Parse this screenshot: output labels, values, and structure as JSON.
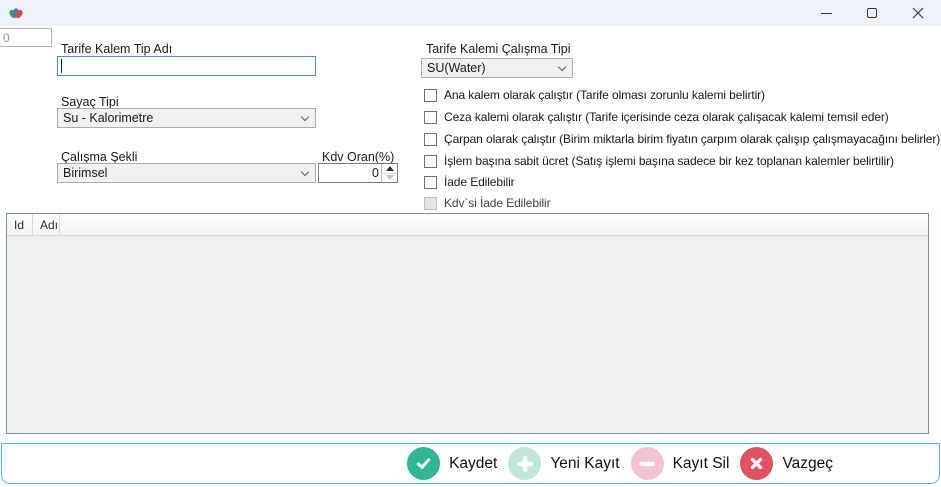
{
  "window": {
    "title": "",
    "icons": {
      "app_logo": "app-logo-icon",
      "minimize": "minimize-icon",
      "maximize": "maximize-icon",
      "close": "close-icon",
      "combo_chevron": "chevron-down-icon",
      "spinner_up": "arrow-up-icon",
      "spinner_down": "arrow-down-icon"
    }
  },
  "header_input": {
    "value": "0"
  },
  "form": {
    "name_field": {
      "label": "Tarife Kalem Tip Adı",
      "value": ""
    },
    "meter_type": {
      "label": "Sayaç Tipi",
      "value": "Su - Kalorimetre"
    },
    "work_mode": {
      "label": "Çalışma Şekli",
      "value": "Birimsel"
    },
    "vat_rate": {
      "label": "Kdv Oran(%)",
      "value": "0"
    },
    "item_work_type": {
      "label": "Tarife Kalemi Çalışma Tipi",
      "value": "SU(Water)"
    },
    "checkboxes": [
      {
        "label": "Ana kalem olarak çalıştır (Tarife olması zorunlu kalemi belirtir)",
        "checked": false,
        "disabled": false
      },
      {
        "label": "Ceza kalemi olarak çalıştır (Tarife içerisinde ceza olarak çalışacak kalemi temsil eder)",
        "checked": false,
        "disabled": false
      },
      {
        "label": "Çarpan olarak çalıştır (Birim miktarla birim fiyatın çarpım olarak çalışıp çalışmayacağını belirler)",
        "checked": false,
        "disabled": false
      },
      {
        "label": "İşlem başına sabit ücret (Satış işlemi başına sadece bir kez toplanan kalemler belirtilir)",
        "checked": false,
        "disabled": false
      },
      {
        "label": "İade Edilebilir",
        "checked": false,
        "disabled": false
      },
      {
        "label": "Kdv`si İade Edilebilir",
        "checked": false,
        "disabled": true
      }
    ]
  },
  "grid": {
    "columns": [
      "Id",
      "Adı"
    ],
    "rows": []
  },
  "toolbar": {
    "buttons": [
      {
        "label": "Kaydet",
        "icon": "check-icon",
        "circle_color": "#2eb896"
      },
      {
        "label": "Yeni Kayıt",
        "icon": "plus-icon",
        "circle_color": "#c3e6da"
      },
      {
        "label": "Kayıt Sil",
        "icon": "minus-icon",
        "circle_color": "#f3c4cd"
      },
      {
        "label": "Vazgeç",
        "icon": "x-icon",
        "circle_color": "#e1525f"
      }
    ]
  },
  "colors": {
    "titlebar_bg": "#eef2f8",
    "focus_border": "#3e8fd3",
    "panel_border": "#5fb6e2",
    "grid_border": "#7092b4"
  }
}
